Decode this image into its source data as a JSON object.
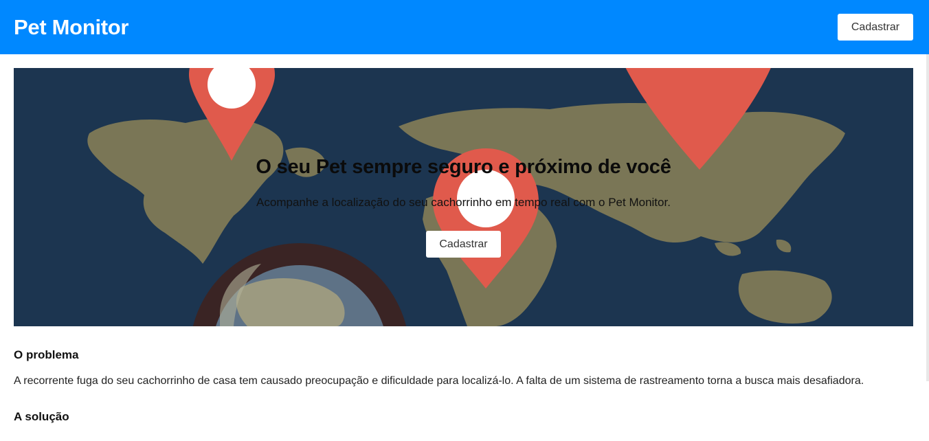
{
  "header": {
    "brand": "Pet Monitor",
    "cta_label": "Cadastrar"
  },
  "hero": {
    "title": "O seu Pet sempre seguro e próximo de você",
    "subtitle": "Acompanhe a localização do seu cachorrinho em tempo real com o Pet Monitor.",
    "cta_label": "Cadastrar",
    "colors": {
      "ocean": "#1c3550",
      "land": "#7a7656",
      "pin": "#e05a4c",
      "lens_ring": "#3a2424"
    },
    "icons": [
      "world-map",
      "location-pin-icon",
      "magnifying-glass"
    ]
  },
  "sections": [
    {
      "heading": "O problema",
      "text": "A recorrente fuga do seu cachorrinho de casa tem causado preocupação e dificuldade para localizá-lo. A falta de um sistema de rastreamento torna a busca mais desafiadora."
    },
    {
      "heading": "A solução",
      "text": ""
    }
  ],
  "colors": {
    "navbar": "#0088ff",
    "page_bg": "#ffffff"
  }
}
